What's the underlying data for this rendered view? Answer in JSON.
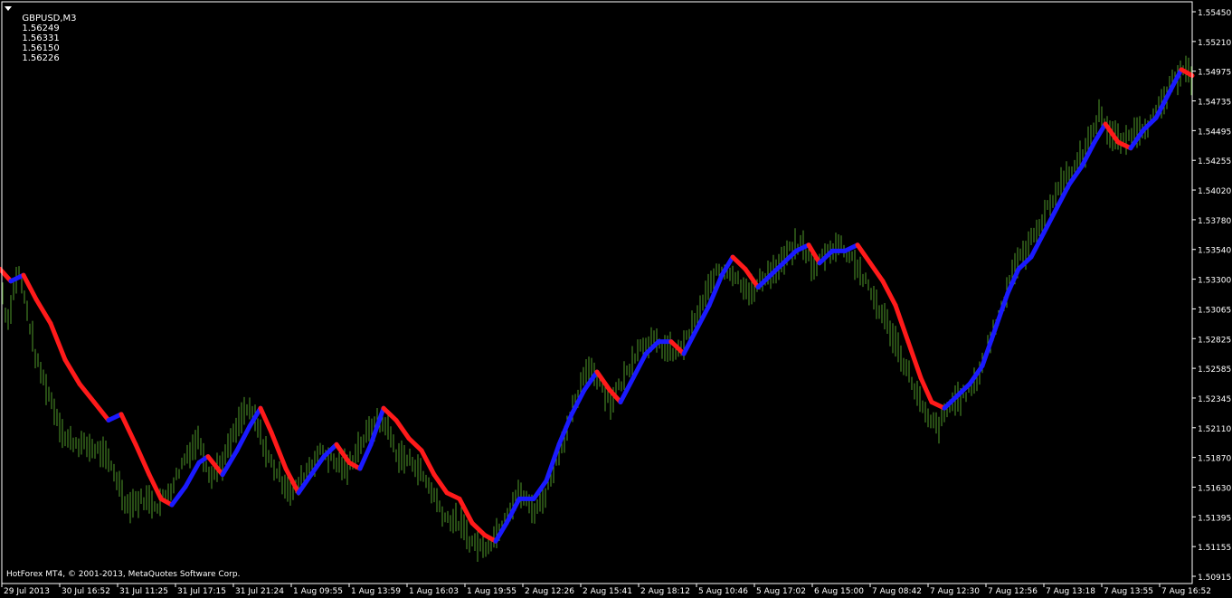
{
  "header": {
    "symbol": "GBPUSD,M3",
    "open": "1.56249",
    "high": "1.56331",
    "low": "1.56150",
    "close": "1.56226"
  },
  "footer": {
    "copyright": "HotForex MT4, © 2001-2013, MetaQuotes Software Corp."
  },
  "colors": {
    "background": "#000000",
    "bars": "#4f9a2a",
    "indicator_up": "#1a1aff",
    "indicator_down": "#ff1a1a",
    "axis": "#ffffff"
  },
  "chart_data": {
    "type": "line",
    "title": "",
    "xlabel": "",
    "ylabel": "",
    "grid": false,
    "ylim": [
      1.5085,
      1.5566
    ],
    "y_ticks": [
      "1.55450",
      "1.55210",
      "1.54975",
      "1.54735",
      "1.54495",
      "1.54255",
      "1.54020",
      "1.53780",
      "1.53540",
      "1.53300",
      "1.53065",
      "1.52825",
      "1.52585",
      "1.52345",
      "1.52110",
      "1.51870",
      "1.51630",
      "1.51395",
      "1.51155",
      "1.50915"
    ],
    "x_ticks": [
      "29 Jul 2013",
      "30 Jul 16:52",
      "31 Jul 11:25",
      "31 Jul 17:15",
      "31 Jul 21:24",
      "1 Aug 09:55",
      "1 Aug 13:59",
      "1 Aug 16:03",
      "1 Aug 19:55",
      "2 Aug 12:26",
      "2 Aug 15:41",
      "2 Aug 18:12",
      "5 Aug 10:46",
      "5 Aug 17:02",
      "6 Aug 15:00",
      "7 Aug 08:42",
      "7 Aug 12:30",
      "7 Aug 12:56",
      "7 Aug 13:18",
      "7 Aug 13:55",
      "7 Aug 16:52"
    ],
    "series": [
      {
        "name": "",
        "kind": "bars",
        "keypoints": [
          [
            0,
            1.534
          ],
          [
            8,
            1.53
          ],
          [
            20,
            1.5345
          ],
          [
            30,
            1.531
          ],
          [
            40,
            1.527
          ],
          [
            55,
            1.524
          ],
          [
            72,
            1.5205
          ],
          [
            90,
            1.52
          ],
          [
            110,
            1.5195
          ],
          [
            125,
            1.518
          ],
          [
            140,
            1.515
          ],
          [
            160,
            1.5155
          ],
          [
            175,
            1.515
          ],
          [
            190,
            1.5165
          ],
          [
            205,
            1.519
          ],
          [
            220,
            1.5205
          ],
          [
            232,
            1.5175
          ],
          [
            246,
            1.5185
          ],
          [
            260,
            1.521
          ],
          [
            272,
            1.523
          ],
          [
            282,
            1.522
          ],
          [
            296,
            1.519
          ],
          [
            312,
            1.517
          ],
          [
            325,
            1.516
          ],
          [
            340,
            1.518
          ],
          [
            356,
            1.5195
          ],
          [
            370,
            1.5185
          ],
          [
            384,
            1.518
          ],
          [
            398,
            1.52
          ],
          [
            412,
            1.5215
          ],
          [
            425,
            1.522
          ],
          [
            440,
            1.519
          ],
          [
            458,
            1.5185
          ],
          [
            475,
            1.5165
          ],
          [
            492,
            1.514
          ],
          [
            508,
            1.5135
          ],
          [
            520,
            1.512
          ],
          [
            534,
            1.5115
          ],
          [
            548,
            1.5125
          ],
          [
            562,
            1.5145
          ],
          [
            575,
            1.516
          ],
          [
            590,
            1.5145
          ],
          [
            604,
            1.516
          ],
          [
            620,
            1.52
          ],
          [
            635,
            1.523
          ],
          [
            650,
            1.5265
          ],
          [
            662,
            1.5255
          ],
          [
            675,
            1.5235
          ],
          [
            690,
            1.5255
          ],
          [
            705,
            1.528
          ],
          [
            720,
            1.5285
          ],
          [
            734,
            1.528
          ],
          [
            748,
            1.5275
          ],
          [
            762,
            1.529
          ],
          [
            776,
            1.5315
          ],
          [
            790,
            1.534
          ],
          [
            805,
            1.5345
          ],
          [
            818,
            1.5335
          ],
          [
            832,
            1.5325
          ],
          [
            846,
            1.534
          ],
          [
            860,
            1.5345
          ],
          [
            873,
            1.536
          ],
          [
            887,
            1.5365
          ],
          [
            900,
            1.5345
          ],
          [
            914,
            1.536
          ],
          [
            928,
            1.5365
          ],
          [
            942,
            1.5355
          ],
          [
            956,
            1.5335
          ],
          [
            970,
            1.5315
          ],
          [
            984,
            1.5295
          ],
          [
            998,
            1.527
          ],
          [
            1012,
            1.5245
          ],
          [
            1025,
            1.522
          ],
          [
            1038,
            1.5215
          ],
          [
            1052,
            1.5235
          ],
          [
            1065,
            1.524
          ],
          [
            1078,
            1.525
          ],
          [
            1092,
            1.528
          ],
          [
            1106,
            1.531
          ],
          [
            1120,
            1.5345
          ],
          [
            1134,
            1.536
          ],
          [
            1148,
            1.538
          ],
          [
            1162,
            1.54
          ],
          [
            1176,
            1.542
          ],
          [
            1190,
            1.543
          ],
          [
            1204,
            1.545
          ],
          [
            1216,
            1.5475
          ],
          [
            1228,
            1.5455
          ],
          [
            1242,
            1.545
          ],
          [
            1256,
            1.546
          ],
          [
            1270,
            1.5465
          ],
          [
            1284,
            1.548
          ],
          [
            1298,
            1.55
          ],
          [
            1310,
            1.5515
          ],
          [
            1318,
            1.55
          ]
        ]
      },
      {
        "name": "",
        "kind": "indicator",
        "keypoints": [
          [
            0,
            1.5345
          ],
          [
            12,
            1.5335
          ],
          [
            26,
            1.534
          ],
          [
            40,
            1.532
          ],
          [
            56,
            1.53
          ],
          [
            72,
            1.527
          ],
          [
            88,
            1.525
          ],
          [
            104,
            1.5235
          ],
          [
            120,
            1.522
          ],
          [
            134,
            1.5225
          ],
          [
            150,
            1.52
          ],
          [
            165,
            1.5175
          ],
          [
            178,
            1.5155
          ],
          [
            190,
            1.515
          ],
          [
            205,
            1.5165
          ],
          [
            220,
            1.5185
          ],
          [
            230,
            1.519
          ],
          [
            246,
            1.5175
          ],
          [
            262,
            1.5195
          ],
          [
            276,
            1.5215
          ],
          [
            288,
            1.523
          ],
          [
            300,
            1.521
          ],
          [
            316,
            1.518
          ],
          [
            330,
            1.516
          ],
          [
            344,
            1.5175
          ],
          [
            358,
            1.519
          ],
          [
            372,
            1.52
          ],
          [
            386,
            1.5185
          ],
          [
            398,
            1.518
          ],
          [
            410,
            1.52
          ],
          [
            424,
            1.523
          ],
          [
            438,
            1.522
          ],
          [
            452,
            1.5205
          ],
          [
            466,
            1.5195
          ],
          [
            480,
            1.5175
          ],
          [
            494,
            1.516
          ],
          [
            508,
            1.5155
          ],
          [
            522,
            1.5135
          ],
          [
            536,
            1.5125
          ],
          [
            548,
            1.512
          ],
          [
            560,
            1.5135
          ],
          [
            574,
            1.5155
          ],
          [
            590,
            1.5155
          ],
          [
            604,
            1.517
          ],
          [
            618,
            1.52
          ],
          [
            632,
            1.5225
          ],
          [
            646,
            1.5245
          ],
          [
            660,
            1.526
          ],
          [
            674,
            1.5245
          ],
          [
            686,
            1.5235
          ],
          [
            700,
            1.5255
          ],
          [
            714,
            1.5275
          ],
          [
            728,
            1.5285
          ],
          [
            742,
            1.5285
          ],
          [
            756,
            1.5275
          ],
          [
            770,
            1.5295
          ],
          [
            784,
            1.5315
          ],
          [
            798,
            1.534
          ],
          [
            810,
            1.5355
          ],
          [
            824,
            1.5345
          ],
          [
            838,
            1.533
          ],
          [
            852,
            1.534
          ],
          [
            866,
            1.535
          ],
          [
            880,
            1.536
          ],
          [
            894,
            1.5365
          ],
          [
            906,
            1.535
          ],
          [
            920,
            1.536
          ],
          [
            934,
            1.536
          ],
          [
            948,
            1.5365
          ],
          [
            962,
            1.535
          ],
          [
            976,
            1.5335
          ],
          [
            990,
            1.5315
          ],
          [
            1004,
            1.5285
          ],
          [
            1018,
            1.5255
          ],
          [
            1030,
            1.5235
          ],
          [
            1044,
            1.523
          ],
          [
            1058,
            1.524
          ],
          [
            1072,
            1.525
          ],
          [
            1086,
            1.5265
          ],
          [
            1100,
            1.5295
          ],
          [
            1114,
            1.5325
          ],
          [
            1126,
            1.5345
          ],
          [
            1140,
            1.5355
          ],
          [
            1154,
            1.5375
          ],
          [
            1168,
            1.5395
          ],
          [
            1182,
            1.5415
          ],
          [
            1196,
            1.543
          ],
          [
            1210,
            1.545
          ],
          [
            1222,
            1.5465
          ],
          [
            1236,
            1.545
          ],
          [
            1250,
            1.5445
          ],
          [
            1264,
            1.546
          ],
          [
            1278,
            1.547
          ],
          [
            1292,
            1.549
          ],
          [
            1306,
            1.551
          ],
          [
            1318,
            1.5505
          ]
        ]
      }
    ]
  }
}
